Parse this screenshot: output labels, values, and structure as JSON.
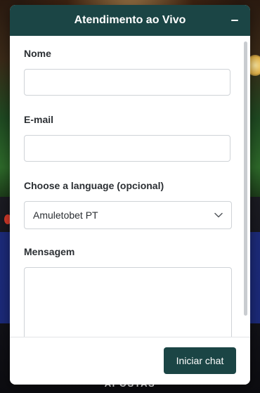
{
  "widget": {
    "title": "Atendimento ao Vivo",
    "minimize_icon": "minus-icon",
    "colors": {
      "header_bg": "#1b4545",
      "button_bg": "#1b4545"
    }
  },
  "form": {
    "name_label": "Nome",
    "name_value": "",
    "email_label": "E-mail",
    "email_value": "",
    "language_label": "Choose a language (opcional)",
    "language_selected": "Amuletobet PT",
    "language_icon": "chevron-down-icon",
    "message_label": "Mensagem",
    "message_value": ""
  },
  "footer": {
    "start_button_label": "Iniciar chat"
  },
  "background": {
    "footer_label": "APOSTAS"
  }
}
